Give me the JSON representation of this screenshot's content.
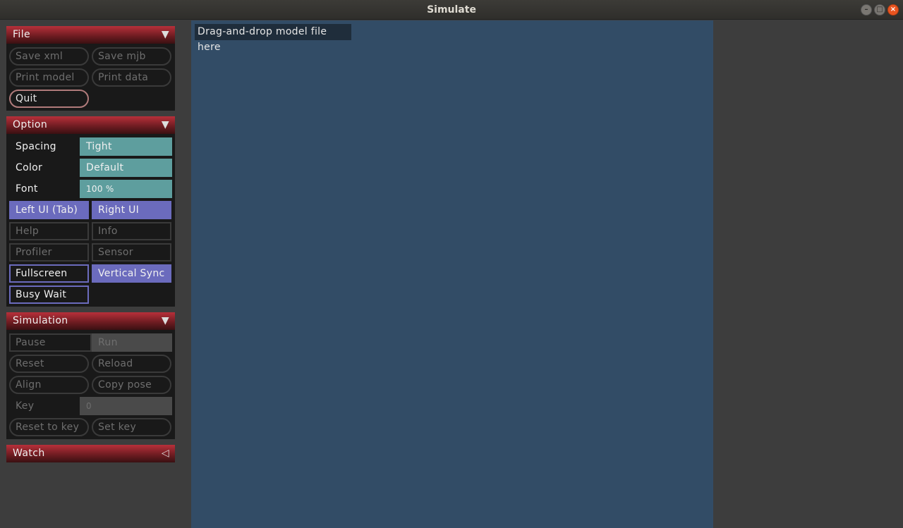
{
  "window": {
    "title": "Simulate"
  },
  "viewport": {
    "hint": "Drag-and-drop model file here"
  },
  "file": {
    "title": "File",
    "save_xml": "Save xml",
    "save_mjb": "Save mjb",
    "print_model": "Print model",
    "print_data": "Print data",
    "quit": "Quit"
  },
  "option": {
    "title": "Option",
    "spacing_label": "Spacing",
    "spacing_value": "Tight",
    "color_label": "Color",
    "color_value": "Default",
    "font_label": "Font",
    "font_value": "100 %",
    "left_ui": "Left UI (Tab)",
    "right_ui": "Right UI",
    "help": "Help",
    "info": "Info",
    "profiler": "Profiler",
    "sensor": "Sensor",
    "fullscreen": "Fullscreen",
    "vertical_sync": "Vertical Sync",
    "busy_wait": "Busy Wait"
  },
  "simulation": {
    "title": "Simulation",
    "pause": "Pause",
    "run": "Run",
    "reset": "Reset",
    "reload": "Reload",
    "align": "Align",
    "copy_pose": "Copy pose",
    "key_label": "Key",
    "key_value": "0",
    "reset_to_key": "Reset to key",
    "set_key": "Set key"
  },
  "watch": {
    "title": "Watch"
  },
  "colors": {
    "section_header": "#8a2228",
    "select_bg": "#5e9e9e",
    "toggle_on": "#6b6bbd",
    "viewport_bg": "#324c66"
  }
}
